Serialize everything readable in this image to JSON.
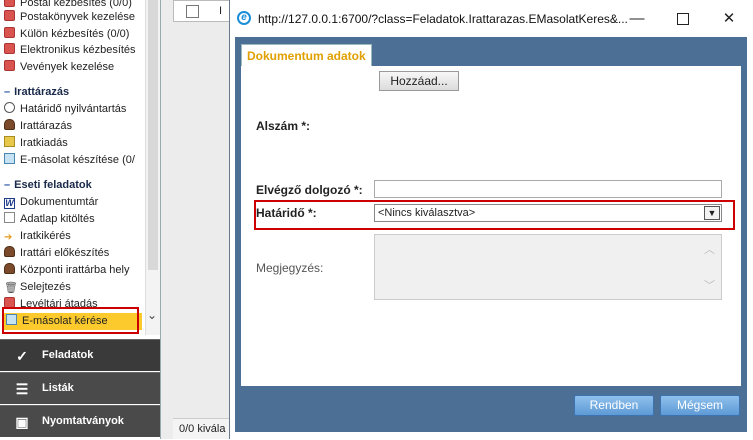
{
  "sidebar": {
    "items": [
      {
        "label": "Postai kézbesítés (0/0)",
        "icon": "red-envelope-icon"
      },
      {
        "label": "Postakönyvek kezelése",
        "icon": "red-book-icon"
      },
      {
        "label": "Külön kézbesítés (0/0)",
        "icon": "red-envelope-icon"
      },
      {
        "label": "Elektronikus kézbesítés",
        "icon": "red-envelope-icon"
      },
      {
        "label": "Vevények kezelése",
        "icon": "red-receipt-icon"
      }
    ],
    "section_irattarazas": "Irattárazás",
    "irattarazas_items": [
      {
        "label": "Határidő nyilvántartás",
        "icon": "clock-icon"
      },
      {
        "label": "Irattárazás",
        "icon": "archive-icon"
      },
      {
        "label": "Iratkiadás",
        "icon": "yellow-folder-icon"
      },
      {
        "label": "E-másolat készítése (0/",
        "icon": "copy-icon"
      }
    ],
    "section_eseti": "Eseti feladatok",
    "eseti_items": [
      {
        "label": "Dokumentumtár",
        "icon": "word-icon"
      },
      {
        "label": "Adatlap kitöltés",
        "icon": "form-icon"
      },
      {
        "label": "Iratkikérés",
        "icon": "arrow-in-icon"
      },
      {
        "label": "Irattári előkészítés",
        "icon": "archive-icon"
      },
      {
        "label": "Központi irattárba hely",
        "icon": "archive-icon"
      },
      {
        "label": "Selejtezés",
        "icon": "trash-icon"
      },
      {
        "label": "Levéltári átadás",
        "icon": "red-box-icon"
      },
      {
        "label": "E-másolat kérése",
        "icon": "copy-request-icon",
        "selected": true
      }
    ],
    "bottom_nav": [
      {
        "label": "Feladatok",
        "icon": "checkmark-icon"
      },
      {
        "label": "Listák",
        "icon": "list-icon"
      },
      {
        "label": "Nyomtatványok",
        "icon": "print-icon"
      }
    ]
  },
  "background": {
    "header_fragment": "I",
    "footer_text": "0/0 kivála"
  },
  "dialog": {
    "title": "http://127.0.0.1:6700/?class=Feladatok.Irattarazas.EMasolatKeres&...",
    "tab_label": "Dokumentum adatok",
    "add_button": "Hozzáad...",
    "alszam_label": "Alszám *:",
    "elvegzo_label": "Elvégző dolgozó *:",
    "hatarido_label": "Határidő *:",
    "hatarido_value": "<Nincs kiválasztva>",
    "megjegyzes_label": "Megjegyzés:",
    "ok_button": "Rendben",
    "cancel_button": "Mégsem"
  },
  "colors": {
    "accent_yellow": "#fcca2c",
    "highlight_red": "#cc0000",
    "dialog_frame": "#4c6f96",
    "button_blue": "#5e9ad6"
  }
}
